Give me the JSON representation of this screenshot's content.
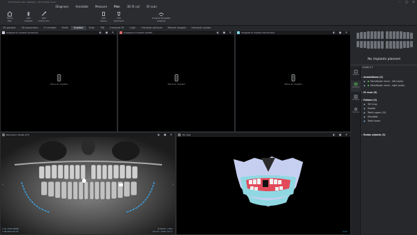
{
  "app": {
    "title": "DTX Studio Clinic (Patient) - DTX Studio Clinic",
    "window_controls": [
      "–",
      "□",
      "✕"
    ]
  },
  "menu": {
    "items": [
      {
        "label": "Diagnose",
        "active": false
      },
      {
        "label": "Annotate",
        "active": false
      },
      {
        "label": "Measure",
        "active": false
      },
      {
        "label": "Plan",
        "active": true
      },
      {
        "label": "3D IX cut",
        "active": false
      },
      {
        "label": "IO scan",
        "active": false
      }
    ]
  },
  "ribbon": {
    "buttons": [
      {
        "label": "Home\nPlan",
        "icon": "home-icon"
      },
      {
        "label": "Add\nimplant",
        "icon": "implant-icon"
      },
      {
        "label": "Add\nanchor pin",
        "icon": "pin-icon"
      },
      {
        "label": "Add\nsleeve",
        "icon": "sleeve-icon"
      },
      {
        "label": "Add\nabutment",
        "icon": "abutment-icon"
      },
      {
        "label": "Surgical template\nanalysis",
        "icon": "template-icon"
      }
    ]
  },
  "tabs": [
    "3D patient",
    "2D panoramic",
    "IO models",
    "Teeth",
    "Implant",
    "Ends",
    "TMJ",
    "Intraoral IM",
    "Ceph",
    "Intraoral pictures",
    "Recent images",
    "Intraoral combo"
  ],
  "active_tab": "Implant",
  "views": {
    "v1": {
      "title": "Snapped to implant (proposal)",
      "color": "#cfcfe0",
      "placeholder": "Place an implant"
    },
    "v2": {
      "title": "Snapped to implant (width)",
      "color": "#d96a6a",
      "placeholder": "Place an implant"
    },
    "v3": {
      "title": "Snapped to implant (horizontal)",
      "color": "#7fd0e0",
      "placeholder": "Place an implant"
    },
    "pano": {
      "title": "Panoramic Strata (CT)"
    },
    "threed": {
      "title": "3D view"
    }
  },
  "pano_overlay": {
    "top_left_lines": [
      "L 0 A2",
      "ID: 38"
    ],
    "bottom_left_lines": [
      "L HL 1556.00069",
      "7-08-2023 00:23"
    ],
    "bottom_right_lines": [
      "W 6000 L 1300",
      "HU 0.5 | 6765 mm 2"
    ]
  },
  "threed_overlay": {
    "bottom_right": "Auto"
  },
  "right_panel": {
    "no_implants": "No implants planned",
    "section_title": "VISIBILITY",
    "rows": [
      {
        "label": "Annotations (2)",
        "head": true,
        "dot": ""
      },
      {
        "label": "Mandibular nerve - left (auto)",
        "head": false,
        "dot": "#5ad25a"
      },
      {
        "label": "Mandibular nerve - right (auto)",
        "head": false,
        "dot": "#5ad25a"
      },
      {
        "label": "IO scan (0)",
        "head": true,
        "dot": ""
      },
      {
        "label": "Patient (3)",
        "head": true,
        "dot": ""
      },
      {
        "label": "3D X-ray",
        "head": false,
        "dot": ""
      },
      {
        "label": "Maxilla",
        "head": false,
        "dot": ""
      },
      {
        "label": "Teeth upper (14)",
        "head": false,
        "dot": ""
      },
      {
        "label": "Mandible",
        "head": false,
        "dot": ""
      },
      {
        "label": "Teeth lower",
        "head": false,
        "dot": ""
      },
      {
        "label": "Redox objects (3)",
        "head": true,
        "dot": ""
      }
    ],
    "sidebar": [
      {
        "label": "Objects",
        "icon": "cube-icon"
      },
      {
        "label": "Visibility",
        "icon": "eye-icon"
      },
      {
        "label": "Findings",
        "icon": "finding-icon"
      },
      {
        "label": "Options",
        "icon": "gear-icon"
      }
    ]
  },
  "colors": {
    "accent": "#2f9fd6",
    "nerve": "#39a0e0",
    "gum": "#e24a5a",
    "bone": "#c7cff0"
  }
}
